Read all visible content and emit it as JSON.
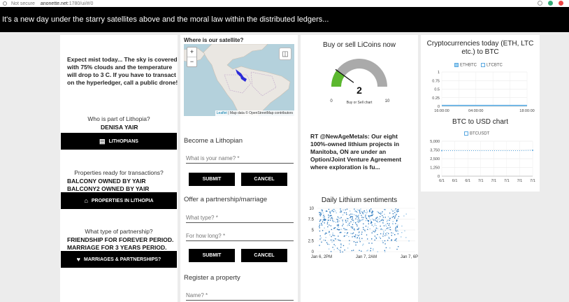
{
  "browser": {
    "security": "Not secure",
    "url_host": "anonette.net",
    "url_path": ":1780/ui/#/0"
  },
  "banner": {
    "text": "It's a new day under the starry satellites above and the moral law within the distributed ledgers..."
  },
  "weather": {
    "text": "Expect mist today... The sky is covered with 75% clouds and the temperature will drop to 3 C. If you have to transact on the hyperledger, call a public drone!"
  },
  "members": {
    "question": "Who is part of Lithopia?",
    "answer": "DENISA YAIR",
    "button_label": "LITHOPIANS",
    "button_icon": "person-badge-icon"
  },
  "properties": {
    "question": "Properties ready for transactions?",
    "answers": [
      "BALCONY OWNED BY YAIR",
      "BALCONY2 OWNED BY YAIR"
    ],
    "button_label": "PROPERTIES IN LITHOPIA",
    "button_icon": "home-icon"
  },
  "partnership": {
    "question": "What type of partnership?",
    "answers": [
      "FRIENDSHIP FOR FOREVER PERIOD.",
      "MARRIAGE FOR 3 YEARS PERIOD."
    ],
    "button_label": "MARRIAGES & PARTNERSHIPS?",
    "button_icon": "heart-icon"
  },
  "map": {
    "title": "Where is our satellite?",
    "zoom_in": "+",
    "zoom_out": "−",
    "attribution_leaflet": "Leaflet",
    "attribution_rest": "| Map data © OpenStreetMap contributors"
  },
  "forms": {
    "become": {
      "title": "Become a Lithopian",
      "name_placeholder": "What is your name?",
      "submit": "SUBMIT",
      "cancel": "CANCEL"
    },
    "offer": {
      "title": "Offer a partnership/marriage",
      "type_placeholder": "What type?",
      "duration_placeholder": "For how long?",
      "submit": "SUBMIT",
      "cancel": "CANCEL"
    },
    "register": {
      "title": "Register a property",
      "name_placeholder": "Name?"
    },
    "required_mark": "*"
  },
  "gauge": {
    "title": "Buy or sell LiCoins now",
    "value": 2,
    "min": 0,
    "max": 10,
    "caption": "Buy or Sell chart",
    "fill_color": "#5cb82f",
    "track_color": "#aaaaaa"
  },
  "tweet": {
    "text": "RT @NewAgeMetals: Our eight 100%-owned lithium projects in Manitoba, ON are under an Option/Joint Venture Agreement where exploration is fu..."
  },
  "chart_data": [
    {
      "type": "line",
      "title": "Cryptocurrencies today (ETH, LTC etc.) to BTC",
      "series": [
        {
          "name": "ETHBTC",
          "values": [
            0.03,
            0.03,
            0.03,
            0.03,
            0.03,
            0.03
          ]
        },
        {
          "name": "LTCBTC",
          "values": [
            0.01,
            0.01,
            0.01,
            0.01,
            0.01,
            0.01
          ]
        }
      ],
      "x": [
        "16:00:00",
        "",
        "04:00:00",
        "",
        "",
        "18:00:00"
      ],
      "y_ticks": [
        "0",
        "0.25",
        "0.5",
        "0.75",
        "1"
      ],
      "ylim": [
        0,
        1
      ],
      "grid": true,
      "legend": "top"
    },
    {
      "type": "line",
      "title": "BTC to USD chart",
      "series": [
        {
          "name": "BTCUSDT",
          "values": [
            3650,
            3650,
            3650,
            3650,
            3650,
            3650,
            3650,
            3700
          ]
        }
      ],
      "x": [
        "6/1",
        "6/1",
        "6/1",
        "7/1",
        "7/1",
        "7/1",
        "7/1",
        "7/1"
      ],
      "y_ticks": [
        "0",
        "1,250",
        "2,500",
        "3,750",
        "5,000"
      ],
      "ylim": [
        0,
        5000
      ],
      "grid": true,
      "legend": "top"
    },
    {
      "type": "scatter",
      "title": "Daily Lithium sentiments",
      "x_ticks": [
        "Jan 6, 2PM",
        "Jan 7, 2AM",
        "Jan 7, 6PM"
      ],
      "y_ticks": [
        "0",
        "2.5",
        "5",
        "7.5",
        "10"
      ],
      "ylim": [
        0,
        10
      ],
      "grid": true
    }
  ]
}
